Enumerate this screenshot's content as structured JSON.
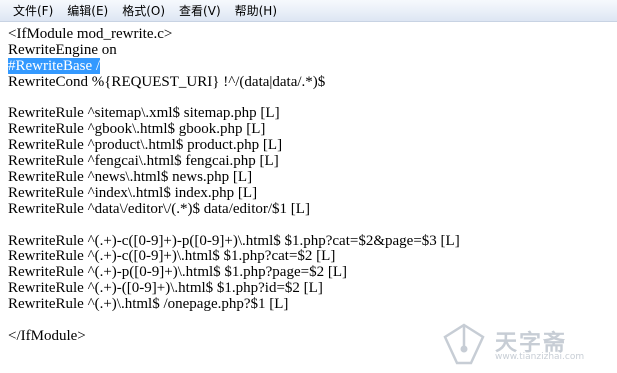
{
  "menu": {
    "items": [
      {
        "label": "文件(F)"
      },
      {
        "label": "编辑(E)"
      },
      {
        "label": "格式(O)"
      },
      {
        "label": "查看(V)"
      },
      {
        "label": "帮助(H)"
      }
    ]
  },
  "editor": {
    "lines": [
      "<IfModule mod_rewrite.c>",
      "RewriteEngine on",
      "#RewriteBase /",
      "RewriteCond %{REQUEST_URI} !^/(data|data/.*)$",
      "",
      "RewriteRule ^sitemap\\.xml$ sitemap.php [L]",
      "RewriteRule ^gbook\\.html$ gbook.php [L]",
      "RewriteRule ^product\\.html$ product.php [L]",
      "RewriteRule ^fengcai\\.html$ fengcai.php [L]",
      "RewriteRule ^news\\.html$ news.php [L]",
      "RewriteRule ^index\\.html$ index.php [L]",
      "RewriteRule ^data\\/editor\\/(.*)$ data/editor/$1 [L]",
      "",
      "RewriteRule ^(.+)-c([0-9]+)-p([0-9]+)\\.html$ $1.php?cat=$2&page=$3 [L]",
      "RewriteRule ^(.+)-c([0-9]+)\\.html$ $1.php?cat=$2 [L]",
      "RewriteRule ^(.+)-p([0-9]+)\\.html$ $1.php?page=$2 [L]",
      "RewriteRule ^(.+)-([0-9]+)\\.html$ $1.php?id=$2 [L]",
      "RewriteRule ^(.+)\\.html$ /onepage.php?$1 [L]",
      "",
      "</IfModule>"
    ],
    "selected_line_index": 2
  },
  "watermark": {
    "text": "天字斋",
    "url": "www.tianzizhai.com",
    "icon": "pen-nib-icon"
  }
}
